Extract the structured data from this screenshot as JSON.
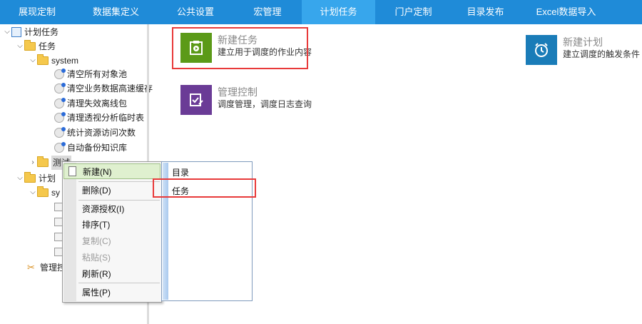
{
  "nav": {
    "tabs": [
      {
        "label": "展现定制"
      },
      {
        "label": "数据集定义"
      },
      {
        "label": "公共设置"
      },
      {
        "label": "宏管理"
      },
      {
        "label": "计划任务"
      },
      {
        "label": "门户定制"
      },
      {
        "label": "目录发布"
      },
      {
        "label": "Excel数据导入"
      }
    ],
    "active_tab": "计划任务"
  },
  "tree": {
    "root_label": "计划任务",
    "tasks_label": "任务",
    "system_label": "system",
    "system_tasks": [
      "清空所有对象池",
      "清空业务数据高速缓存",
      "清理失效离线包",
      "清理透视分析临时表",
      "统计资源访问次数",
      "自动备份知识库"
    ],
    "test_label": "测试",
    "plan_label": "计划",
    "plan_system_label": "sy",
    "manage_label": "管理控"
  },
  "tiles": {
    "new_task": {
      "title": "新建任务",
      "subtitle": "建立用于调度的作业内容",
      "color": "#5b9a18"
    },
    "new_plan": {
      "title": "新建计划",
      "subtitle": "建立调度的触发条件",
      "color": "#1a7cb8"
    },
    "manage": {
      "title": "管理控制",
      "subtitle": "调度管理，调度日志查询",
      "color": "#6a3b96"
    }
  },
  "context_menu": {
    "items": [
      {
        "label": "新建(N)",
        "disabled": false,
        "selected": true
      },
      {
        "label": "删除(D)",
        "disabled": false
      },
      {
        "label": "资源授权(I)",
        "disabled": false
      },
      {
        "label": "排序(T)",
        "disabled": false
      },
      {
        "label": "复制(C)",
        "disabled": true
      },
      {
        "label": "粘贴(S)",
        "disabled": true
      },
      {
        "label": "刷新(R)",
        "disabled": false
      },
      {
        "label": "属性(P)",
        "disabled": false
      }
    ]
  },
  "submenu": {
    "items": [
      {
        "label": "目录"
      },
      {
        "label": "任务"
      }
    ]
  },
  "colors": {
    "nav_bg": "#1f8bd8",
    "nav_active": "#37a6ec",
    "highlight": "#e83a3a"
  }
}
